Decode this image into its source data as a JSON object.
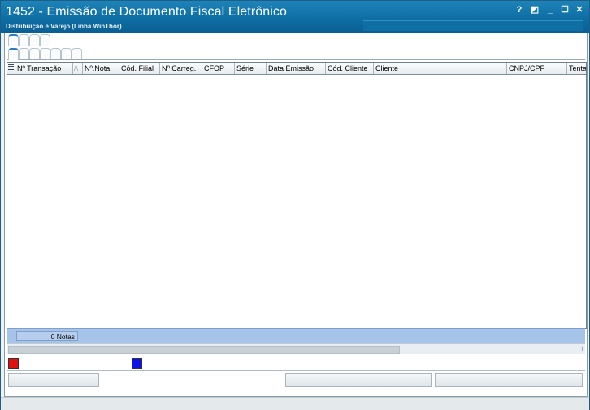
{
  "window": {
    "title": "1452 - Emissão de Documento Fiscal Eletrônico",
    "subtitle": "Distribuição e Varejo (Linha WinThor)",
    "controls": {
      "help": "?",
      "restore": "◩",
      "minimize": "_",
      "maximize": "☐",
      "close": "✕"
    }
  },
  "grid": {
    "indicator_icon": "column-chooser-icon",
    "sort_glyph": "/\\",
    "columns": [
      {
        "label": "Nº Transação"
      },
      {
        "label": "Nº.Nota"
      },
      {
        "label": "Cód. Filial"
      },
      {
        "label": "Nº Carreg."
      },
      {
        "label": "CFOP"
      },
      {
        "label": "Série"
      },
      {
        "label": "Data Emissão"
      },
      {
        "label": "Cód. Cliente"
      },
      {
        "label": "Cliente"
      },
      {
        "label": "CNPJ/CPF"
      },
      {
        "label": "Tenta"
      }
    ]
  },
  "footer": {
    "notes_count": "0 Notas"
  },
  "legend": {
    "red_color": "#e01010",
    "blue_color": "#0a14e8"
  }
}
